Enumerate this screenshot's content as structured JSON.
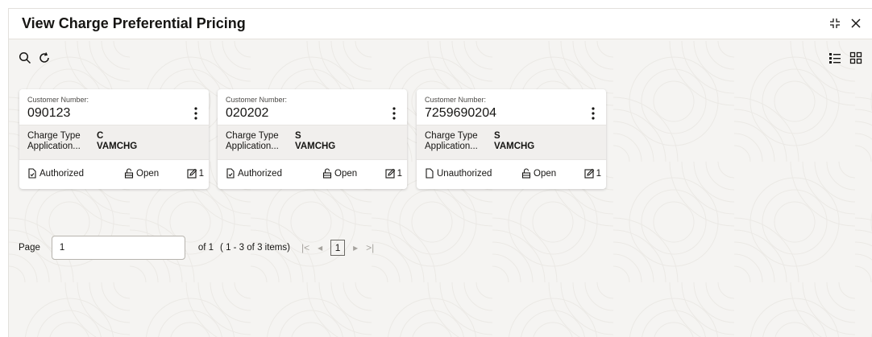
{
  "window": {
    "title": "View Charge Preferential Pricing"
  },
  "icons": {
    "minimize": "collapse-arrows-icon",
    "close": "close-icon",
    "search": "search-icon",
    "refresh": "refresh-icon",
    "list_view": "list-view-icon",
    "grid_view": "grid-view-icon"
  },
  "cards": [
    {
      "customer_label": "Customer Number:",
      "customer_number": "090123",
      "charge_type_label": "Charge Type",
      "charge_type": "C",
      "application_label": "Application...",
      "application": "VAMCHG",
      "auth_status": "Authorized",
      "record_status": "Open",
      "version": "1"
    },
    {
      "customer_label": "Customer Number:",
      "customer_number": "020202",
      "charge_type_label": "Charge Type",
      "charge_type": "S",
      "application_label": "Application...",
      "application": "VAMCHG",
      "auth_status": "Authorized",
      "record_status": "Open",
      "version": "1"
    },
    {
      "customer_label": "Customer Number:",
      "customer_number": "7259690204",
      "charge_type_label": "Charge Type",
      "charge_type": "S",
      "application_label": "Application...",
      "application": "VAMCHG",
      "auth_status": "Unauthorized",
      "record_status": "Open",
      "version": "1"
    }
  ],
  "pagination": {
    "page_label": "Page",
    "page_value": "1",
    "of_text": "of 1",
    "range_text": "( 1 - 3 of 3 items)",
    "current_page": "1",
    "first": "|<",
    "prev": "◂",
    "next": "▸",
    "last": ">|"
  },
  "colors": {
    "background": "#f5f4f2",
    "card": "#ffffff",
    "card_band": "#f1efed",
    "text": "#161513"
  }
}
